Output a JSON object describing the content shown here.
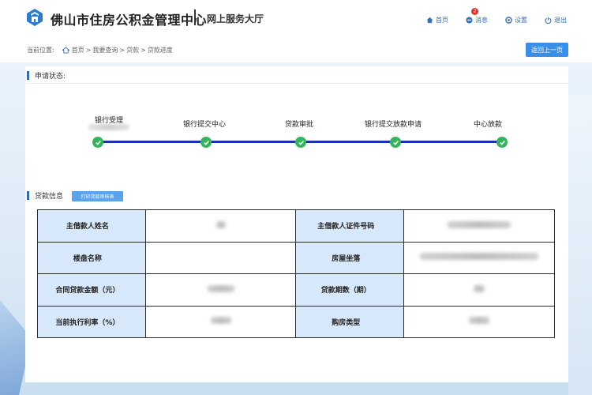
{
  "header": {
    "site_title": "佛山市住房公积金管理中心",
    "sub_title": "网上服务大厅",
    "nav": {
      "home": "首页",
      "messages": "消息",
      "message_count": "2",
      "settings": "设置",
      "logout": "退出"
    }
  },
  "breadcrumb": {
    "prefix": "当前位置:",
    "items": [
      "首页",
      "我要查询",
      "贷款",
      "贷款进度"
    ],
    "separator": ">"
  },
  "back_button": "返回上一页",
  "status_section": {
    "title": "申请状态:",
    "steps": [
      {
        "label": "银行受理",
        "done": true
      },
      {
        "label": "银行提交中心",
        "done": true
      },
      {
        "label": "贷款审批",
        "done": true
      },
      {
        "label": "银行提交放款申请",
        "done": true
      },
      {
        "label": "中心放款",
        "done": true
      }
    ]
  },
  "loan_section": {
    "title": "贷款信息",
    "print_button": "打印贷款审核表",
    "rows": [
      {
        "label1": "主借款人姓名",
        "label2": "主借款人证件号码"
      },
      {
        "label1": "楼盘名称",
        "label2": "房屋坐落"
      },
      {
        "label1": "合同贷款金额（元）",
        "label2": "贷款期数（期）"
      },
      {
        "label1": "当前执行利率（%）",
        "label2": "购房类型"
      }
    ]
  },
  "colors": {
    "accent": "#3b8ee6",
    "track": "#1e2fb0",
    "step_done": "#36b45a",
    "label_cell": "#d7e8fa"
  }
}
